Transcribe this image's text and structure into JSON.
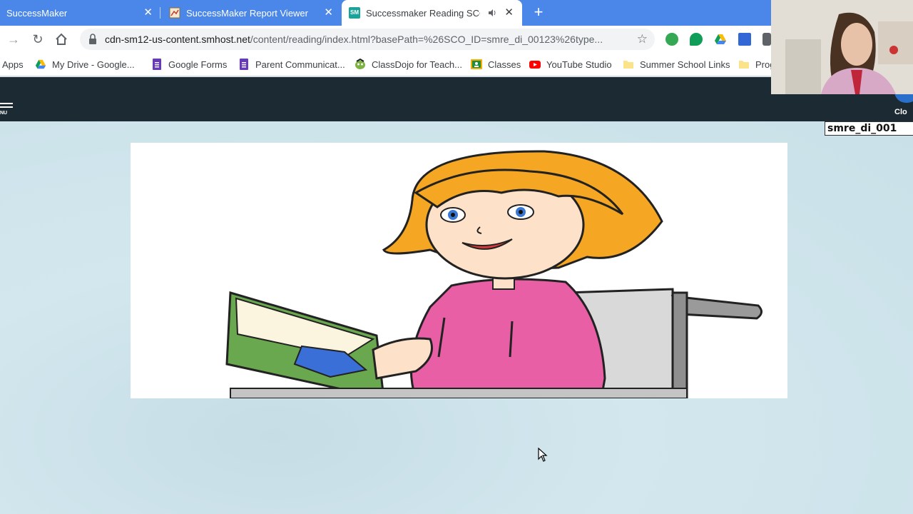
{
  "browser": {
    "tabs": [
      {
        "title": "SuccessMaker",
        "close": "✕"
      },
      {
        "title": "SuccessMaker Report Viewer",
        "close": "✕"
      },
      {
        "title": "Successmaker Reading SCO",
        "close": "✕",
        "favicon_text": "SM"
      }
    ],
    "new_tab": "+",
    "url_host": "cdn-sm12-us-content.smhost.net",
    "url_path": "/content/reading/index.html?basePath=%26SCO_ID=smre_di_00123%26type...",
    "bookmarks": [
      {
        "label": "Apps"
      },
      {
        "label": "My Drive - Google..."
      },
      {
        "label": "Google Forms"
      },
      {
        "label": "Parent Communicat..."
      },
      {
        "label": "ClassDojo for Teach..."
      },
      {
        "label": "Classes"
      },
      {
        "label": "YouTube Studio"
      },
      {
        "label": "Summer School Links"
      },
      {
        "label": "Prog"
      }
    ]
  },
  "app": {
    "menu_label": "NU",
    "close_label": "Clo",
    "sco_id": "smre_di_001"
  },
  "colors": {
    "tabstrip": "#4a87e8",
    "header": "#1c2b33",
    "background": "#cfe3ea"
  }
}
